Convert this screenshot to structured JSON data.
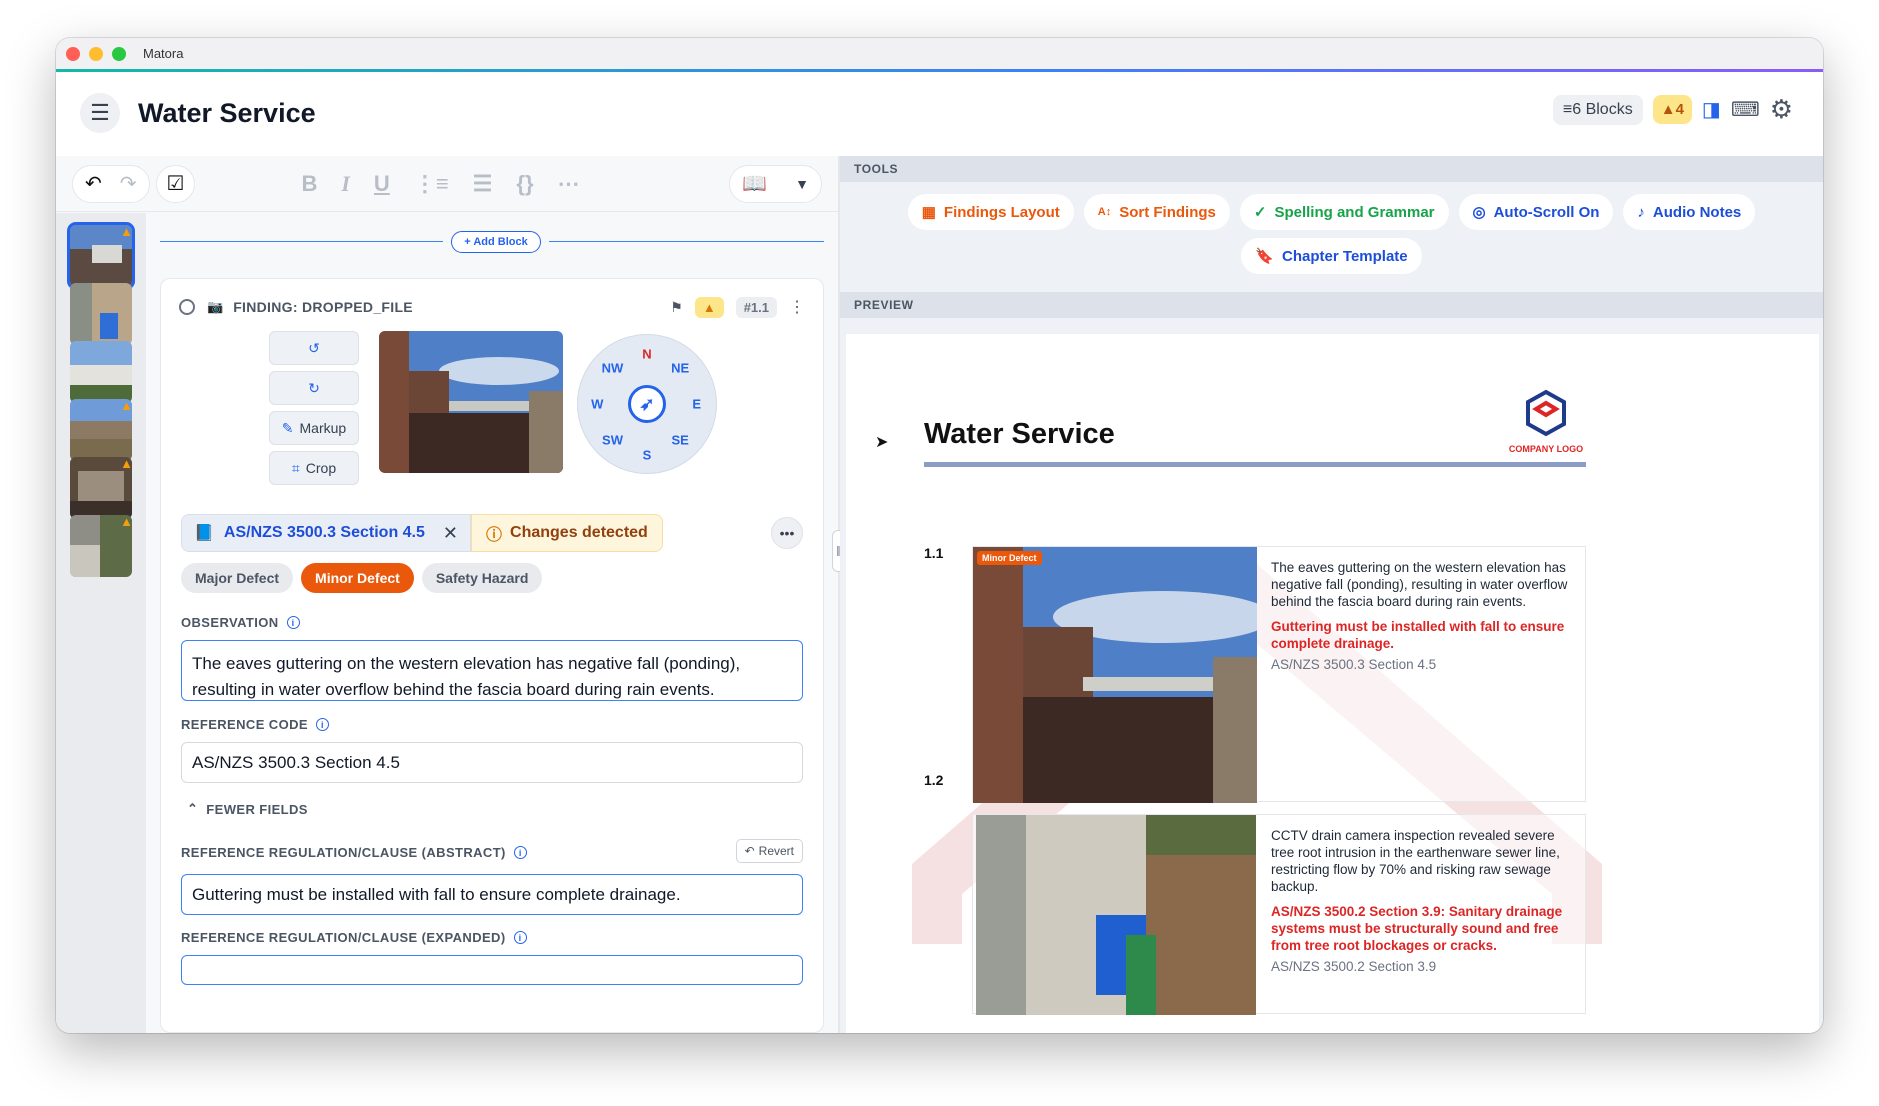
{
  "window": {
    "title": "Matora"
  },
  "header": {
    "title": "Water Service",
    "blocks_label": "6 Blocks",
    "warnings_label": "4"
  },
  "editor": {
    "add_block_label": "+ Add Block",
    "finding": {
      "name": "FINDING: DROPPED_FILE",
      "number": "#1.1",
      "controls": {
        "markup": "Markup",
        "crop": "Crop"
      },
      "compass": {
        "n": "N",
        "ne": "NE",
        "e": "E",
        "se": "SE",
        "s": "S",
        "sw": "SW",
        "w": "W",
        "nw": "NW"
      },
      "reference_chip": "AS/NZS 3500.3 Section 4.5",
      "changes_label": "Changes detected",
      "tags": [
        "Major Defect",
        "Minor Defect",
        "Safety Hazard"
      ],
      "active_tag": "Minor Defect",
      "observation_label": "OBSERVATION",
      "observation_value": "The eaves guttering on the western elevation has negative fall (ponding), resulting in water overflow behind the fascia board during rain events.",
      "reference_code_label": "REFERENCE CODE",
      "reference_code_value": "AS/NZS 3500.3 Section 4.5",
      "fewer_fields_label": "FEWER FIELDS",
      "abstract_label": "REFERENCE REGULATION/CLAUSE (ABSTRACT)",
      "revert_label": "Revert",
      "abstract_value": "Guttering must be installed with fall to ensure complete drainage.",
      "expanded_label": "REFERENCE REGULATION/CLAUSE (EXPANDED)"
    }
  },
  "tools": {
    "section_label": "TOOLS",
    "buttons": [
      {
        "label": "Findings Layout",
        "icon": "grid-icon"
      },
      {
        "label": "Sort Findings",
        "icon": "sort-az-icon"
      },
      {
        "label": "Spelling and Grammar",
        "icon": "spellcheck-icon"
      },
      {
        "label": "Auto-Scroll On",
        "icon": "target-icon"
      },
      {
        "label": "Audio Notes",
        "icon": "music-note-icon"
      },
      {
        "label": "Chapter Template",
        "icon": "bookmark-icon"
      }
    ]
  },
  "preview": {
    "section_label": "PREVIEW",
    "title": "Water Service",
    "logo_text": "COMPANY LOGO",
    "findings": [
      {
        "number": "1.1",
        "badge": "Minor Defect",
        "observation": "The eaves guttering on the western elevation has negative fall (ponding), resulting in water overflow behind the fascia board during rain events.",
        "regulation": "Guttering must be installed with fall to ensure complete drainage.",
        "code": "AS/NZS 3500.3 Section 4.5"
      },
      {
        "number": "1.2",
        "observation": "CCTV drain camera inspection revealed severe tree root intrusion in the earthenware sewer line, restricting flow by 70% and risking raw sewage backup.",
        "regulation": "AS/NZS 3500.2 Section 3.9: Sanitary drainage systems must be structurally sound and free from tree root blockages or cracks.",
        "code": "AS/NZS 3500.2 Section 3.9"
      }
    ]
  },
  "colors": {
    "accent": "#2563eb",
    "orange": "#ea580c",
    "warning": "#f59e0b",
    "danger": "#dc2626"
  }
}
